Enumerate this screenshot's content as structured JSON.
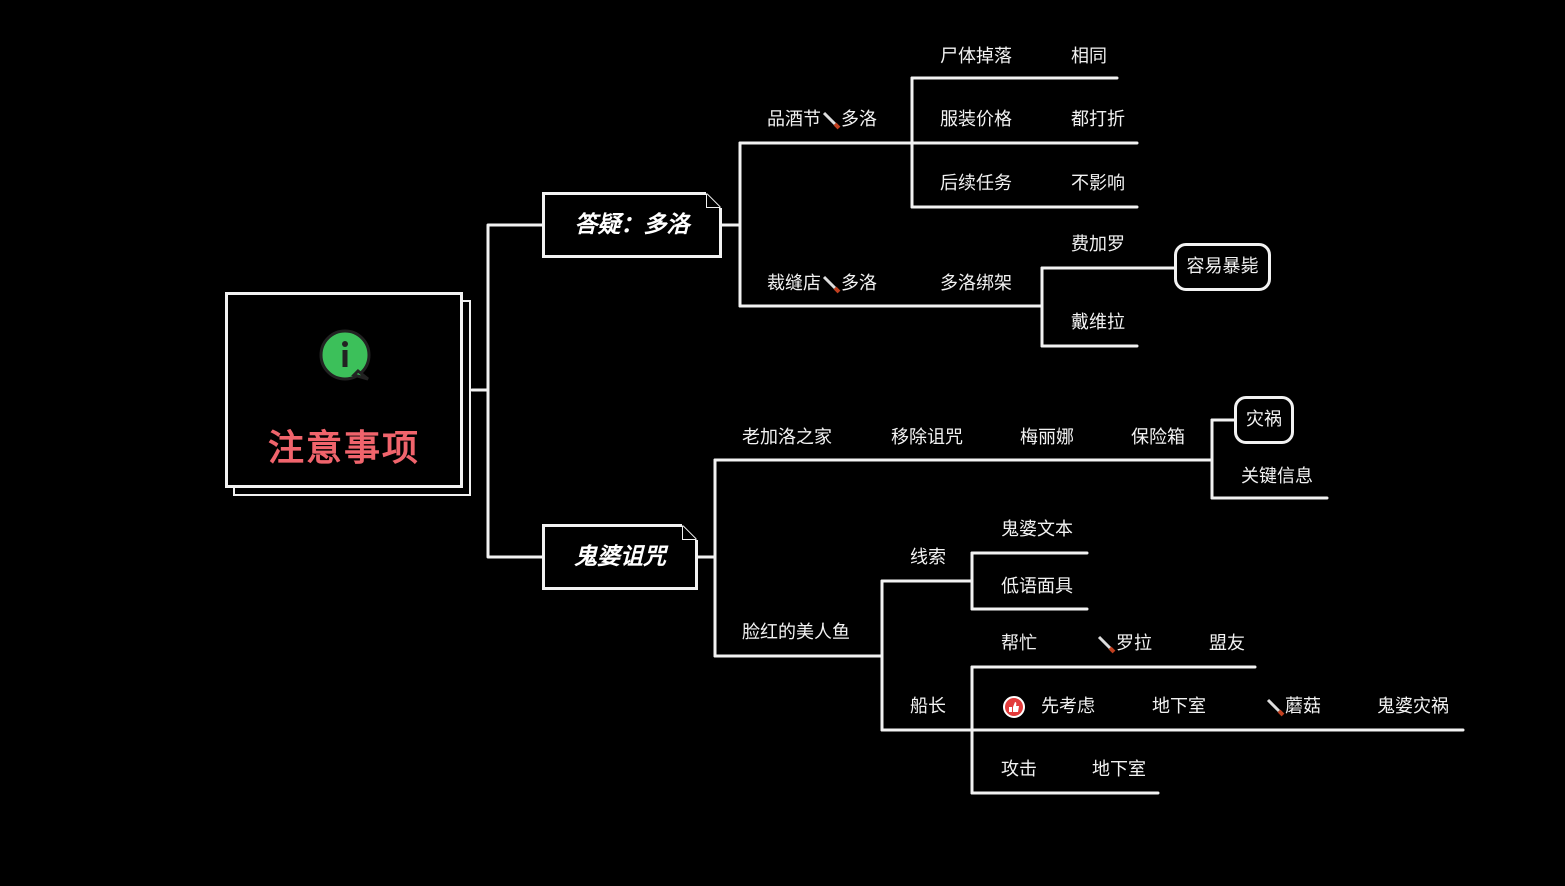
{
  "root": {
    "title": "注意事项",
    "icon": "info-bubble-icon",
    "icon_color": "#3cc05a",
    "title_color": "#f0646c"
  },
  "branch_a": {
    "title": "答疑：多洛",
    "wine": {
      "label": "品酒节",
      "suffix": "多洛",
      "rows": [
        {
          "key": "尸体掉落",
          "value": "相同"
        },
        {
          "key": "服装价格",
          "value": "都打折"
        },
        {
          "key": "后续任务",
          "value": "不影响"
        }
      ]
    },
    "tailor": {
      "label": "裁缝店",
      "suffix": "多洛",
      "next": "多洛绑架",
      "options": [
        "费加罗",
        "戴维拉"
      ],
      "result": "容易暴毙"
    }
  },
  "branch_b": {
    "title": "鬼婆诅咒",
    "home": {
      "label": "老加洛之家",
      "chain": [
        "移除诅咒",
        "梅丽娜",
        "保险箱"
      ],
      "outcomes": [
        "灾祸",
        "关键信息"
      ]
    },
    "mermaid": {
      "label": "脸红的美人鱼",
      "clues": {
        "label": "线索",
        "items": [
          "鬼婆文本",
          "低语面具"
        ]
      },
      "captain": {
        "label": "船长",
        "help": {
          "label": "帮忙",
          "target": "罗拉",
          "result": "盟友"
        },
        "first": {
          "label": "先考虑",
          "chain": [
            "地下室",
            "蘑菇",
            "鬼婆灾祸"
          ]
        },
        "attack": {
          "label": "攻击",
          "result": "地下室"
        }
      }
    }
  },
  "colors": {
    "background": "#000000",
    "line": "#f2f2f2",
    "thumb": "#e33b3b"
  }
}
